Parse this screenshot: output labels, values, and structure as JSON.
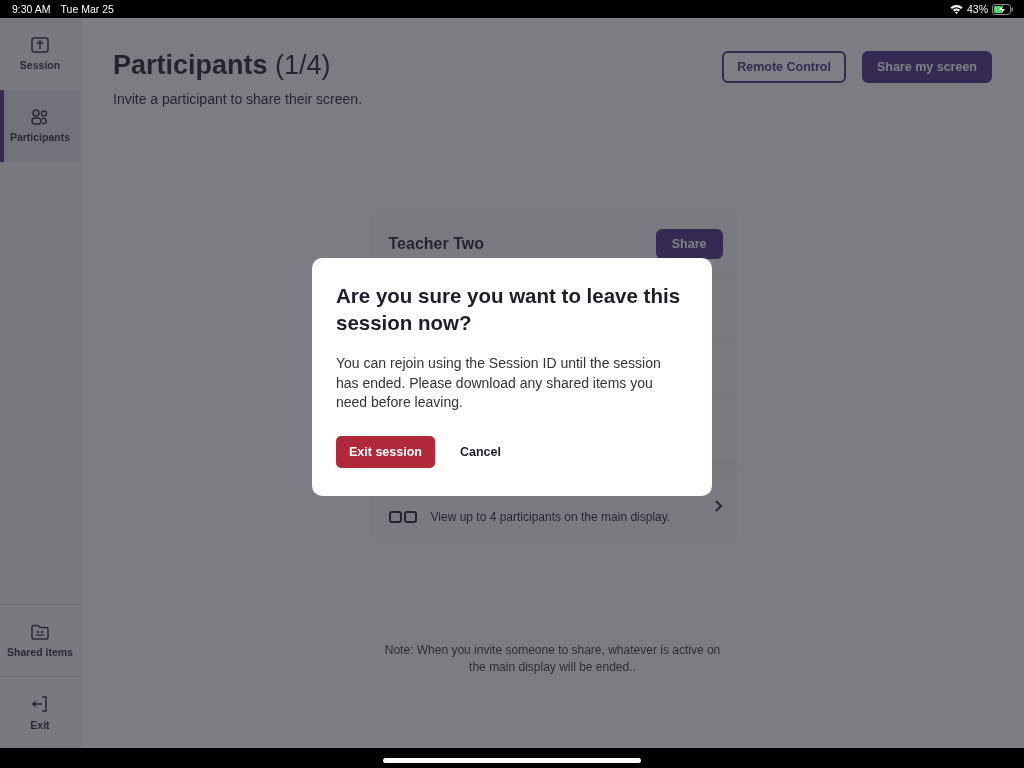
{
  "status_bar": {
    "time": "9:30 AM",
    "date": "Tue Mar 25",
    "battery": "43%"
  },
  "sidebar": {
    "items": [
      {
        "label": "Session",
        "selected": false
      },
      {
        "label": "Participants",
        "selected": true
      },
      {
        "label": "Shared items",
        "selected": false
      },
      {
        "label": "Exit",
        "selected": false
      }
    ]
  },
  "header": {
    "title": "Participants",
    "count": "(1/4)",
    "subtitle": "Invite a participant to share their screen.",
    "buttons": [
      {
        "label": "Remote Control",
        "kind": "outline"
      },
      {
        "label": "Share my screen",
        "kind": "primary"
      }
    ]
  },
  "participants": {
    "rows": [
      {
        "kind": "participant",
        "name": "Teacher Two",
        "button": "Share"
      },
      {
        "kind": "hidden"
      },
      {
        "kind": "hidden"
      },
      {
        "kind": "hidden"
      },
      {
        "kind": "grid",
        "description": "View up to 4 participants on the main display."
      }
    ]
  },
  "note": "Note: When you invite someone to share, whatever is active on the main display will be ended..",
  "dialog": {
    "title": "Are you sure you want to leave this session now?",
    "message": "You can rejoin using the Session ID until the session has ended. Please download any shared items you need before leaving.",
    "buttons": [
      {
        "label": "Exit session",
        "kind": "danger"
      },
      {
        "label": "Cancel",
        "kind": "plain"
      }
    ]
  }
}
